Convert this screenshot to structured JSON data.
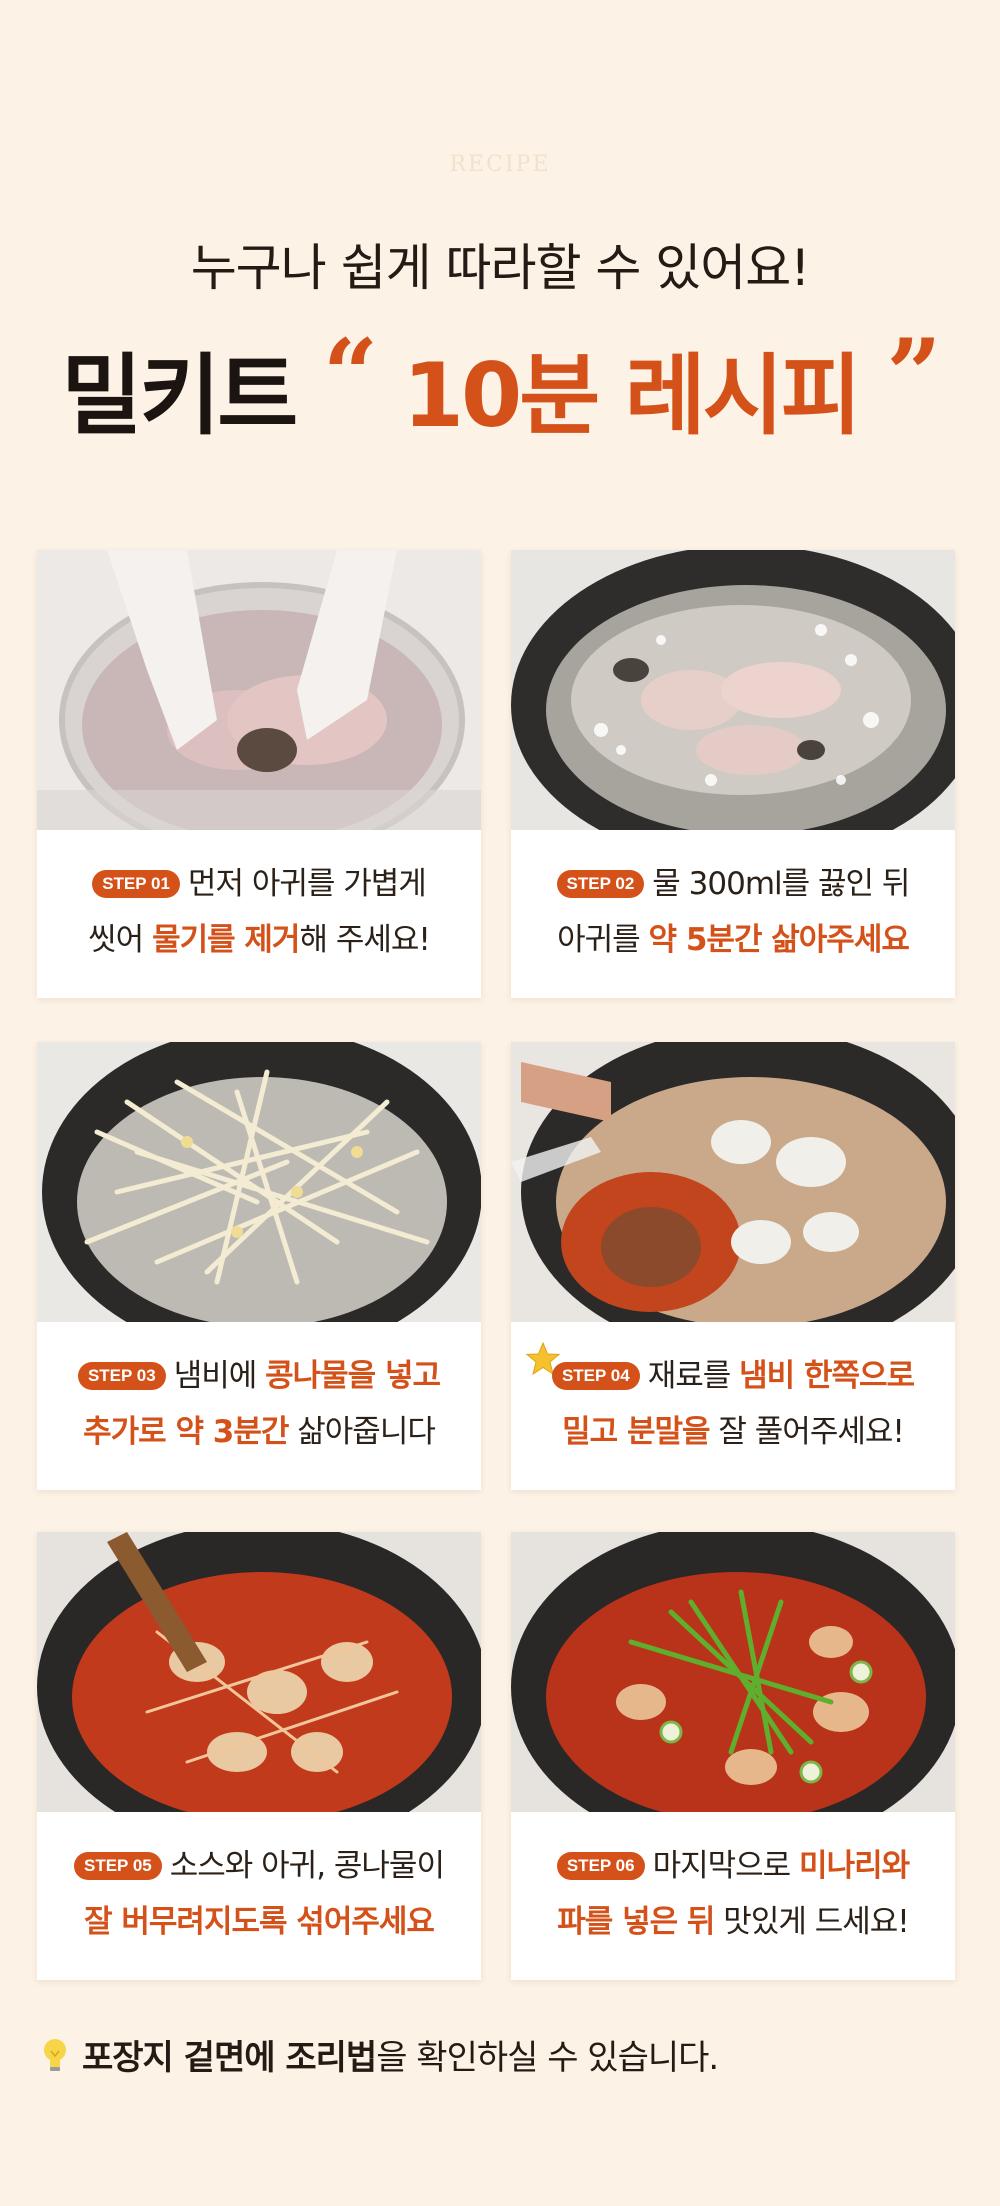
{
  "header": {
    "eyebrow": "RECIPE",
    "subtitle": "누구나 쉽게 따라할 수 있어요!",
    "title_prefix": "밀키트",
    "open_quote": "“",
    "title_accent": "10분 레시피",
    "close_quote": "”"
  },
  "steps": [
    {
      "badge": "STEP 01",
      "l1a": "먼저 아귀를 가볍게",
      "l2a": "씻어 ",
      "l2hl": "물기를 제거",
      "l2b": "해 주세요!",
      "photo": "washing-monkfish-photo"
    },
    {
      "badge": "STEP 02",
      "l1a": "물 300ml를 끓인 뒤",
      "l2a": "아귀를 ",
      "l2hl": "약 5분간 삶아주세요",
      "l2b": "",
      "photo": "boiling-monkfish-photo"
    },
    {
      "badge": "STEP 03",
      "l1a": "냄비에 ",
      "l1hl": "콩나물을 넣고",
      "l2hl": "추가로 약 3분간",
      "l2b": " 삶아줍니다",
      "photo": "bean-sprouts-pot-photo"
    },
    {
      "badge": "STEP 04",
      "l1a": "재료를 ",
      "l1hl": "냄비 한쪽으로",
      "l2hl": "밀고 분말을",
      "l2b": " 잘 풀어주세요!",
      "photo": "adding-seasoning-powder-photo"
    },
    {
      "badge": "STEP 05",
      "l1a": "소스와 아귀, 콩나물이",
      "l2hl": "잘 버무려지도록 섞어주세요",
      "l2b": "",
      "photo": "mixing-sauce-photo"
    },
    {
      "badge": "STEP 06",
      "l1a": "마지막으로 ",
      "l1hl": "미나리와",
      "l2hl": "파를 넣은 뒤",
      "l2b": " 맛있게 드세요!",
      "photo": "finished-agujjim-photo"
    }
  ],
  "footer": {
    "bold": "포장지 겉면에 조리법",
    "rest": "을 확인하실 수 있습니다."
  },
  "colors": {
    "accent": "#d4521a",
    "background": "#fcf2e6"
  }
}
